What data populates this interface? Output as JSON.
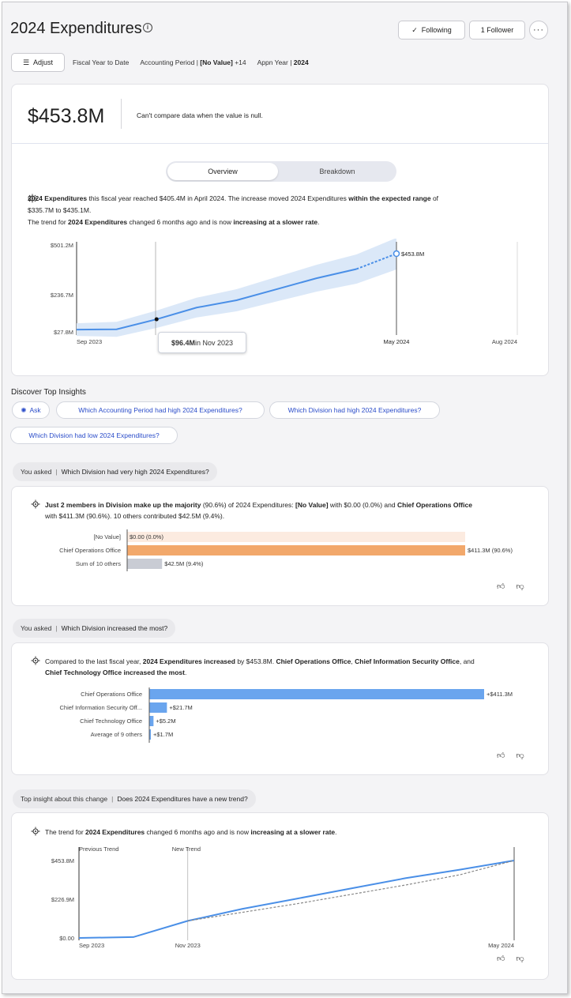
{
  "header": {
    "title": "2024 Expenditures",
    "following_label": "Following",
    "follower_label": "1 Follower",
    "more_label": "···"
  },
  "filters": {
    "adjust_label": "Adjust",
    "items": [
      "Fiscal Year to Date"
    ],
    "accounting_prefix": "Accounting Period | ",
    "accounting_value": "[No Value]",
    "accounting_suffix": " +14",
    "appn_prefix": "Appn Year | ",
    "appn_value": "2024"
  },
  "kpi": {
    "value": "$453.8M",
    "compare_note": "Can't compare data when the value is null."
  },
  "view_toggle": {
    "overview": "Overview",
    "breakdown": "Breakdown"
  },
  "summary": {
    "s1_bold": "2024 Expenditures",
    "s1_a": " this fiscal year reached $405.4M in April 2024. The increase moved 2024 Expenditures ",
    "s1_bold2": "within the expected range",
    "s1_b": " of",
    "s2": "$335.7M to $435.1M.",
    "s3_a": "The trend for ",
    "s3_bold": "2024 Expenditures",
    "s3_b": " changed 6 months ago and is now ",
    "s3_bold2": "increasing at a slower rate",
    "s3_c": "."
  },
  "chart_data": [
    {
      "type": "line",
      "x": [
        "Sep 2023",
        "Oct 2023",
        "Nov 2023",
        "Dec 2023",
        "Jan 2024",
        "Feb 2024",
        "Mar 2024",
        "Apr 2024",
        "May 2024"
      ],
      "series": [
        {
          "values": [
            40,
            42,
            96.4,
            160,
            200,
            260,
            320,
            370,
            453.8
          ]
        }
      ],
      "forecast_point": {
        "x": "May 2024",
        "label": "$453.8M"
      },
      "y_ticks": [
        "$501.2M",
        "$236.7M",
        "$27.8M"
      ],
      "x_ticks": [
        "Sep 2023",
        "May 2024",
        "Aug 2024"
      ],
      "ylim": [
        27.8,
        501.2
      ],
      "band": "expected range",
      "tooltip_value": "$96.4M",
      "tooltip_suffix": " in Nov 2023"
    },
    {
      "type": "bar",
      "categories": [
        "[No Value]",
        "Chief Operations Office",
        "Sum of 10 others"
      ],
      "values": [
        0,
        411.3,
        42.5
      ],
      "labels": [
        "$0.00 (0.0%)",
        "$411.3M (90.6%)",
        "$42.5M (9.4%)"
      ]
    },
    {
      "type": "bar",
      "categories": [
        "Chief Operations Office",
        "Chief Information Security Off...",
        "Chief Technology Office",
        "Average of 9 others"
      ],
      "values": [
        411.3,
        21.7,
        5.2,
        1.7
      ],
      "labels": [
        "+$411.3M",
        "+$21.7M",
        "+$5.2M",
        "+$1.7M"
      ]
    },
    {
      "type": "line",
      "x": [
        "Sep 2023",
        "Oct 2023",
        "Nov 2023",
        "Dec 2023",
        "Jan 2024",
        "Feb 2024",
        "Mar 2024",
        "Apr 2024",
        "May 2024"
      ],
      "series": [
        {
          "name": "",
          "values": [
            0,
            5,
            100,
            170,
            230,
            290,
            350,
            400,
            453.8
          ]
        },
        {
          "name": "New Trend",
          "values": [
            null,
            null,
            100,
            150,
            200,
            255,
            310,
            370,
            453.8
          ]
        }
      ],
      "y_ticks": [
        "$453.8M",
        "$226.9M",
        "$0.00"
      ],
      "x_ticks": [
        "Sep 2023",
        "Nov 2023",
        "May 2024"
      ],
      "annotations": [
        "Previous Trend",
        "New Trend"
      ],
      "ylim": [
        0,
        453.8
      ]
    }
  ],
  "discover": {
    "title": "Discover Top Insights",
    "ask_label": "Ask",
    "q1": "Which Accounting Period had high 2024 Expenditures?",
    "q2": "Which Division had high 2024 Expenditures?",
    "q3": "Which Division had low 2024 Expenditures?"
  },
  "insight1": {
    "asked_prefix": "You asked",
    "question": "Which Division had very high 2024 Expenditures?",
    "t_bold": "Just 2 members in Division make up the majority",
    "t_a": " (90.6%) of 2024 Expenditures: ",
    "t_bold2": "[No Value]",
    "t_b": " with $0.00 (0.0%) and ",
    "t_bold3": "Chief Operations Office",
    "t_c": "with $411.3M (90.6%). 10 others contributed $42.5M (9.4%)."
  },
  "insight2": {
    "asked_prefix": "You asked",
    "question": "Which Division increased the most?",
    "t_a": "Compared to the last fiscal year, ",
    "t_bold": "2024 Expenditures increased",
    "t_b": " by $453.8M. ",
    "t_bold2": "Chief Operations Office",
    "t_c": ", ",
    "t_bold3": "Chief Information Security Office",
    "t_d": ", and",
    "t_bold4": "Chief Technology Office increased the most",
    "t_e": "."
  },
  "insight3": {
    "asked_prefix": "Top insight about this change",
    "question": "Does 2024 Expenditures have a new trend?",
    "t_a": "The trend for ",
    "t_bold": "2024 Expenditures",
    "t_b": " changed 6 months ago and is now ",
    "t_bold2": "increasing at a slower rate",
    "t_c": "."
  },
  "colors": {
    "accent": "#2a4cc9",
    "line": "#4a8fe7",
    "band": "#dbe8f8",
    "orange": "#f2a86b",
    "orange_light": "#fcebe0",
    "gray_bar": "#c9ccd4",
    "blue_bar": "#6aa5ee"
  }
}
